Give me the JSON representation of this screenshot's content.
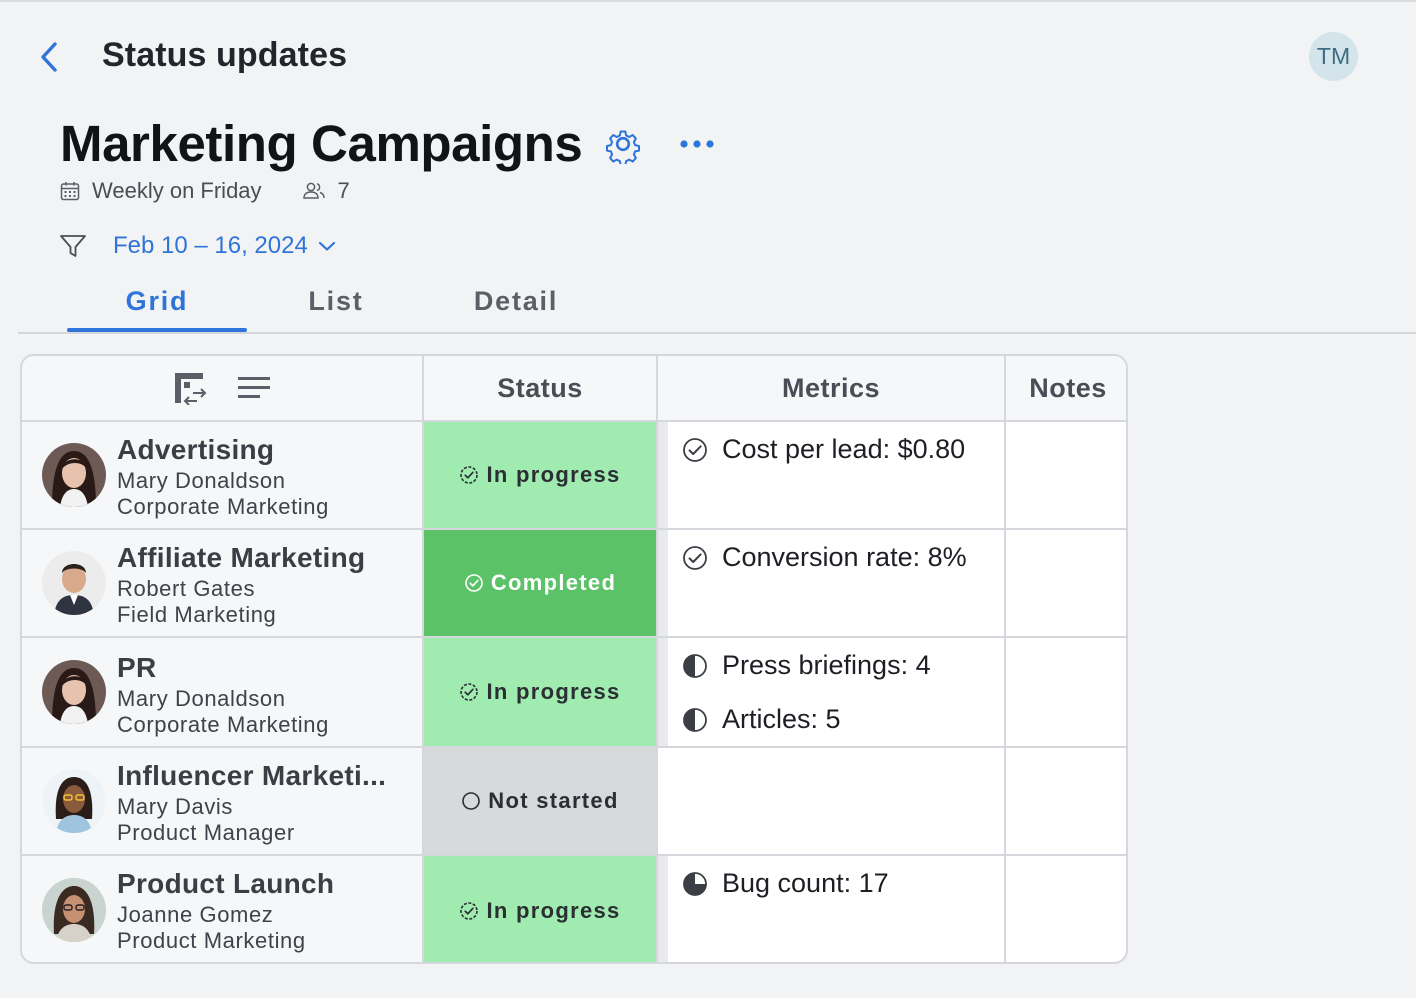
{
  "header": {
    "title": "Status updates",
    "user_initials": "TM"
  },
  "board": {
    "title": "Marketing Campaigns",
    "schedule": "Weekly on Friday",
    "member_count": "7",
    "date_range": "Feb 10 – 16, 2024"
  },
  "tabs": [
    {
      "label": "Grid",
      "active": true
    },
    {
      "label": "List",
      "active": false
    },
    {
      "label": "Detail",
      "active": false
    }
  ],
  "columns": {
    "status": "Status",
    "metrics": "Metrics",
    "notes": "Notes"
  },
  "rows": [
    {
      "project": "Advertising",
      "person": "Mary Donaldson",
      "department": "Corporate Marketing",
      "status": "In progress",
      "metrics": [
        {
          "text": "Cost per lead: $0.80",
          "icon": "check-circle-icon"
        }
      ],
      "notes": ""
    },
    {
      "project": "Affiliate Marketing",
      "person": "Robert Gates",
      "department": "Field Marketing",
      "status": "Completed",
      "metrics": [
        {
          "text": "Conversion rate: 8%",
          "icon": "check-circle-icon"
        }
      ],
      "notes": ""
    },
    {
      "project": "PR",
      "person": "Mary Donaldson",
      "department": "Corporate Marketing",
      "status": "In progress",
      "metrics": [
        {
          "text": "Press briefings: 4",
          "icon": "half-progress-icon"
        },
        {
          "text": "Articles: 5",
          "icon": "half-progress-icon"
        }
      ],
      "notes": ""
    },
    {
      "project": "Influencer Marketi...",
      "person": "Mary Davis",
      "department": "Product Manager",
      "status": "Not started",
      "metrics": [],
      "notes": ""
    },
    {
      "project": "Product Launch",
      "person": "Joanne Gomez",
      "department": "Product Marketing",
      "status": "In progress",
      "metrics": [
        {
          "text": "Bug count: 17",
          "icon": "three-quarter-progress-icon"
        }
      ],
      "notes": ""
    }
  ],
  "colors": {
    "accent": "#2f74d8",
    "in_progress": "#a0ebb0",
    "completed": "#5cc268",
    "not_started": "#d7d9dd"
  }
}
